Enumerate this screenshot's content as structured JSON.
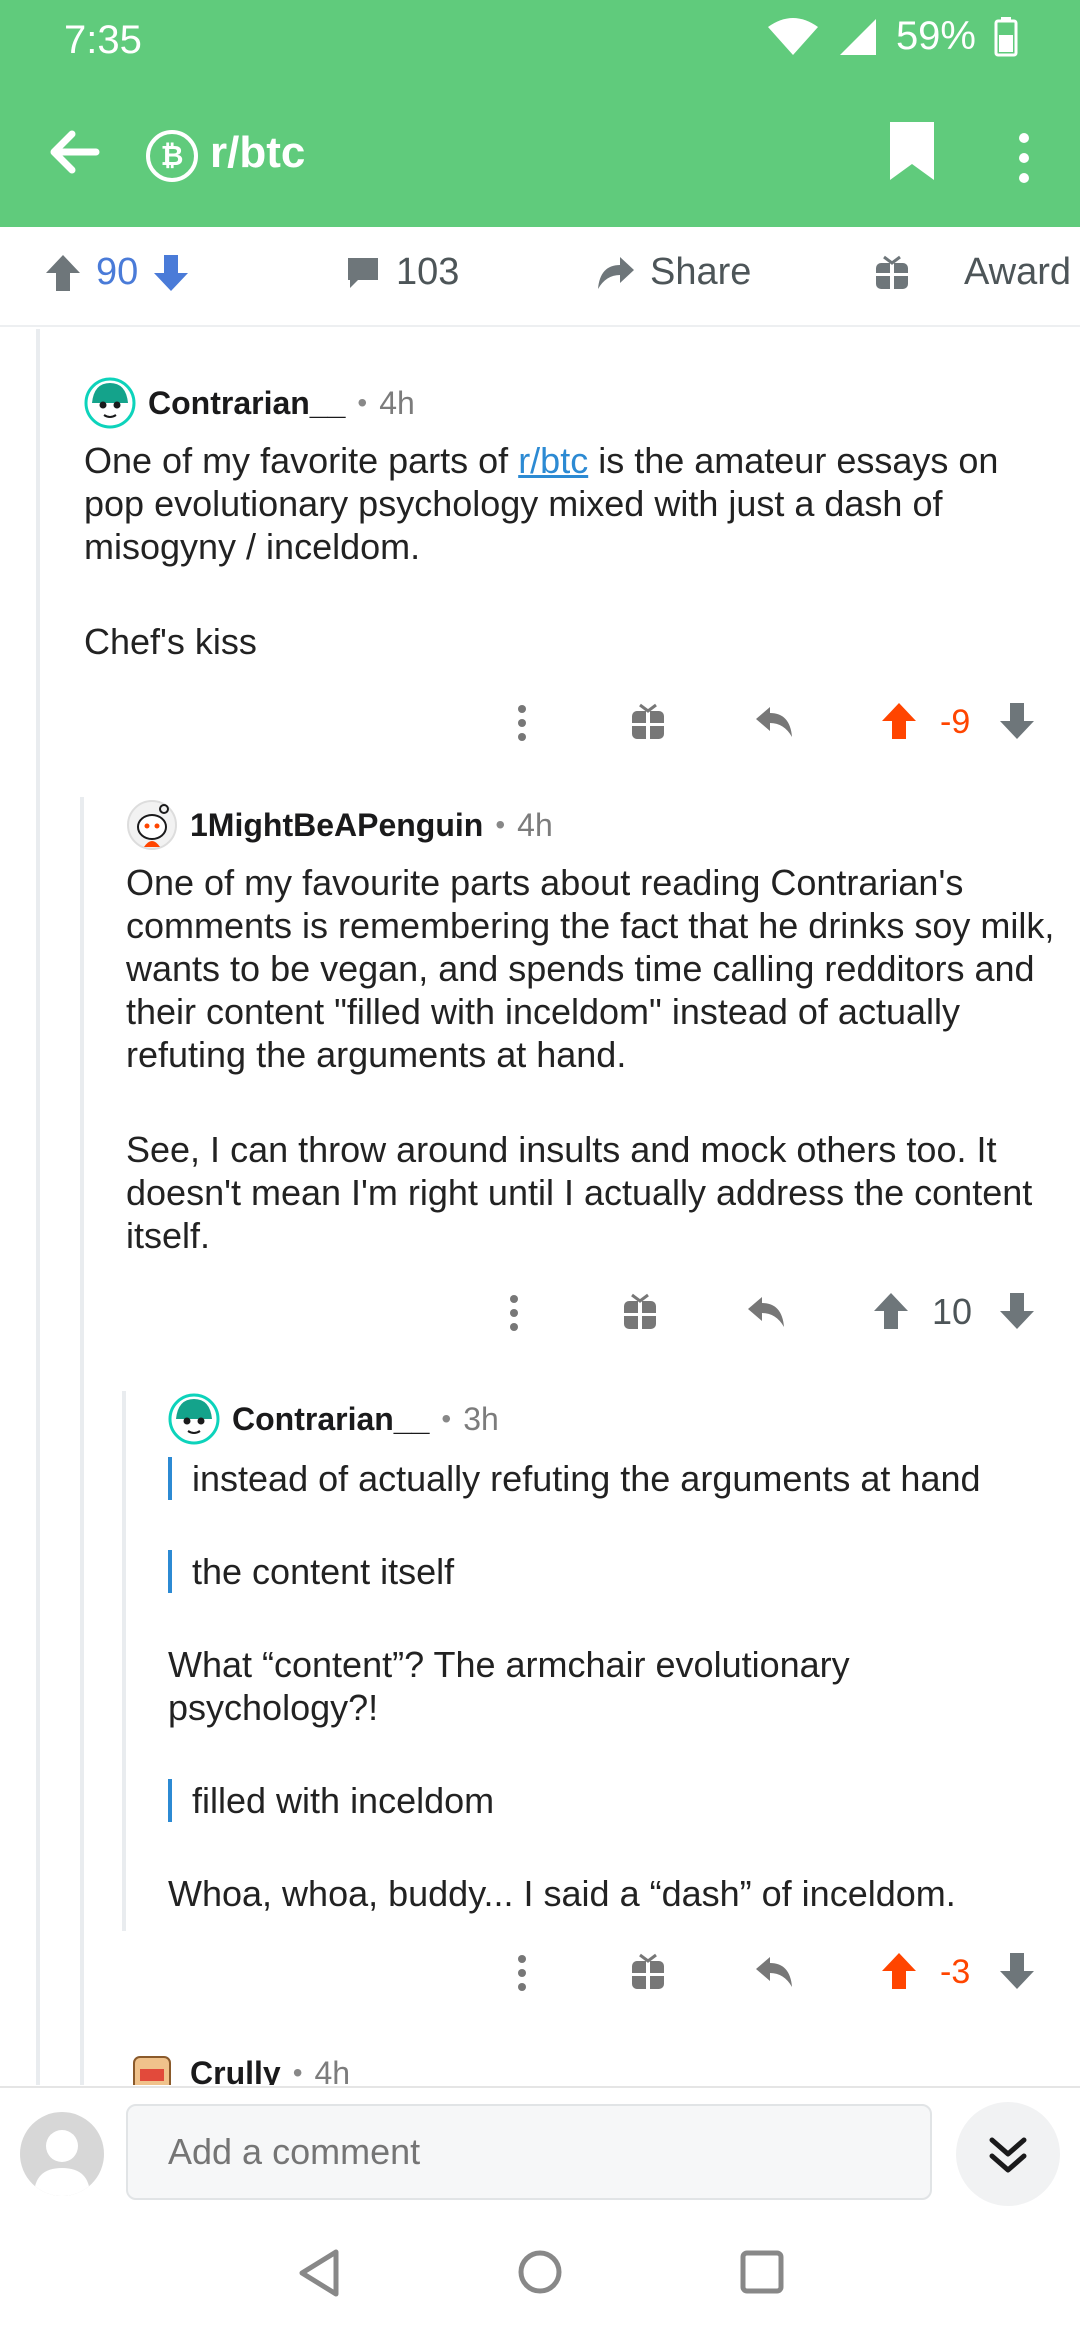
{
  "status": {
    "time": "7:35",
    "battery": "59%"
  },
  "appbar": {
    "subreddit": "r/btc",
    "sub_icon": "₿"
  },
  "post_actions": {
    "votes": "90",
    "comments": "103",
    "share": "Share",
    "award": "Award"
  },
  "comments": [
    {
      "author": "Contrarian__",
      "age": "4h",
      "body_pre": "One of my favorite parts of ",
      "body_link": "r/btc",
      "body_post": " is the amateur essays on pop evolutionary psychology mixed with just a dash of misogyny / inceldom.",
      "body2": "Chef's kiss",
      "score": "-9"
    },
    {
      "author": "1MightBeAPenguin",
      "age": "4h",
      "body1": "One of my favourite parts about reading Contrarian's comments is remembering the fact that he drinks soy milk, wants to be vegan, and spends time calling redditors and their content \"filled with inceldom\" instead of actually refuting the arguments at hand.",
      "body2": "See, I can throw around insults and mock others too. It doesn't mean I'm right until I actually address the content itself.",
      "score": "10"
    },
    {
      "author": "Contrarian__",
      "age": "3h",
      "quote1": "instead of actually refuting the arguments at hand",
      "quote2": "the content itself",
      "body1": "What “content”? The armchair evolutionary psychology?!",
      "quote3": "filled with inceldom",
      "body2": "Whoa, whoa, buddy... I said a “dash” of inceldom.",
      "score": "-3"
    },
    {
      "author": "Crully",
      "age": "4h"
    }
  ],
  "bottom": {
    "placeholder": "Add a comment"
  },
  "colors": {
    "header": "#60cb7c",
    "upvote": "#ff4500",
    "blue": "#4a7bd8",
    "link": "#2c8ad3"
  }
}
